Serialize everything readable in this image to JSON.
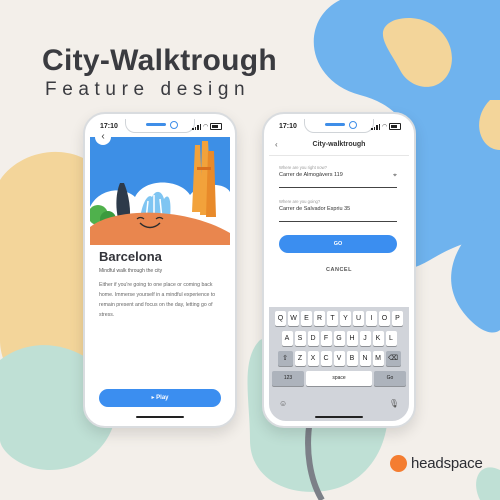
{
  "headline": {
    "title": "City-Walktrough",
    "subtitle": "Feature design"
  },
  "status": {
    "time": "17:10"
  },
  "left_phone": {
    "back_icon": "chevron-left-icon",
    "city_title": "Barcelona",
    "city_subtitle": "Mindful walk through the city",
    "description": "Either if you're going to one place or coming back home. Immerse yourself in a mindful experience to remain present and focus on the day, letting go of stress.",
    "play_label": "▸ Play"
  },
  "right_phone": {
    "nav_title": "City-walktrough",
    "from_label": "Where are you right now?",
    "from_value": "Carrer de Almogàvers 119",
    "to_label": "Where are you going?",
    "to_value": "Carrer de Salvador Espriu 35",
    "go_label": "GO",
    "cancel_label": "CANCEL",
    "keyboard": {
      "row1": [
        "Q",
        "W",
        "E",
        "R",
        "T",
        "Y",
        "U",
        "I",
        "O",
        "P"
      ],
      "row2": [
        "A",
        "S",
        "D",
        "F",
        "G",
        "H",
        "J",
        "K",
        "L"
      ],
      "row3": [
        "Z",
        "X",
        "C",
        "V",
        "B",
        "N",
        "M"
      ],
      "num_label": "123",
      "space_label": "space",
      "go_label": "Go"
    }
  },
  "brand": {
    "name": "headspace"
  },
  "colors": {
    "accent": "#3b8ef0",
    "brand": "#f47d31",
    "yellow": "#f3d59a",
    "teal": "#bfe0d5"
  }
}
